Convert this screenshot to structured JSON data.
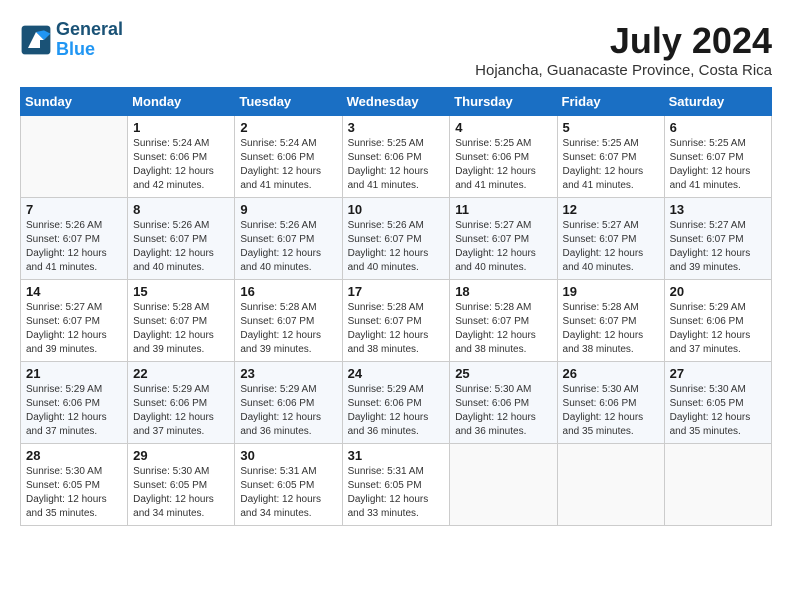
{
  "header": {
    "logo_line1": "General",
    "logo_line2": "Blue",
    "month_year": "July 2024",
    "location": "Hojancha, Guanacaste Province, Costa Rica"
  },
  "columns": [
    "Sunday",
    "Monday",
    "Tuesday",
    "Wednesday",
    "Thursday",
    "Friday",
    "Saturday"
  ],
  "weeks": [
    [
      {
        "day": "",
        "sunrise": "",
        "sunset": "",
        "daylight": ""
      },
      {
        "day": "1",
        "sunrise": "Sunrise: 5:24 AM",
        "sunset": "Sunset: 6:06 PM",
        "daylight": "Daylight: 12 hours and 42 minutes."
      },
      {
        "day": "2",
        "sunrise": "Sunrise: 5:24 AM",
        "sunset": "Sunset: 6:06 PM",
        "daylight": "Daylight: 12 hours and 41 minutes."
      },
      {
        "day": "3",
        "sunrise": "Sunrise: 5:25 AM",
        "sunset": "Sunset: 6:06 PM",
        "daylight": "Daylight: 12 hours and 41 minutes."
      },
      {
        "day": "4",
        "sunrise": "Sunrise: 5:25 AM",
        "sunset": "Sunset: 6:06 PM",
        "daylight": "Daylight: 12 hours and 41 minutes."
      },
      {
        "day": "5",
        "sunrise": "Sunrise: 5:25 AM",
        "sunset": "Sunset: 6:07 PM",
        "daylight": "Daylight: 12 hours and 41 minutes."
      },
      {
        "day": "6",
        "sunrise": "Sunrise: 5:25 AM",
        "sunset": "Sunset: 6:07 PM",
        "daylight": "Daylight: 12 hours and 41 minutes."
      }
    ],
    [
      {
        "day": "7",
        "sunrise": "Sunrise: 5:26 AM",
        "sunset": "Sunset: 6:07 PM",
        "daylight": "Daylight: 12 hours and 41 minutes."
      },
      {
        "day": "8",
        "sunrise": "Sunrise: 5:26 AM",
        "sunset": "Sunset: 6:07 PM",
        "daylight": "Daylight: 12 hours and 40 minutes."
      },
      {
        "day": "9",
        "sunrise": "Sunrise: 5:26 AM",
        "sunset": "Sunset: 6:07 PM",
        "daylight": "Daylight: 12 hours and 40 minutes."
      },
      {
        "day": "10",
        "sunrise": "Sunrise: 5:26 AM",
        "sunset": "Sunset: 6:07 PM",
        "daylight": "Daylight: 12 hours and 40 minutes."
      },
      {
        "day": "11",
        "sunrise": "Sunrise: 5:27 AM",
        "sunset": "Sunset: 6:07 PM",
        "daylight": "Daylight: 12 hours and 40 minutes."
      },
      {
        "day": "12",
        "sunrise": "Sunrise: 5:27 AM",
        "sunset": "Sunset: 6:07 PM",
        "daylight": "Daylight: 12 hours and 40 minutes."
      },
      {
        "day": "13",
        "sunrise": "Sunrise: 5:27 AM",
        "sunset": "Sunset: 6:07 PM",
        "daylight": "Daylight: 12 hours and 39 minutes."
      }
    ],
    [
      {
        "day": "14",
        "sunrise": "Sunrise: 5:27 AM",
        "sunset": "Sunset: 6:07 PM",
        "daylight": "Daylight: 12 hours and 39 minutes."
      },
      {
        "day": "15",
        "sunrise": "Sunrise: 5:28 AM",
        "sunset": "Sunset: 6:07 PM",
        "daylight": "Daylight: 12 hours and 39 minutes."
      },
      {
        "day": "16",
        "sunrise": "Sunrise: 5:28 AM",
        "sunset": "Sunset: 6:07 PM",
        "daylight": "Daylight: 12 hours and 39 minutes."
      },
      {
        "day": "17",
        "sunrise": "Sunrise: 5:28 AM",
        "sunset": "Sunset: 6:07 PM",
        "daylight": "Daylight: 12 hours and 38 minutes."
      },
      {
        "day": "18",
        "sunrise": "Sunrise: 5:28 AM",
        "sunset": "Sunset: 6:07 PM",
        "daylight": "Daylight: 12 hours and 38 minutes."
      },
      {
        "day": "19",
        "sunrise": "Sunrise: 5:28 AM",
        "sunset": "Sunset: 6:07 PM",
        "daylight": "Daylight: 12 hours and 38 minutes."
      },
      {
        "day": "20",
        "sunrise": "Sunrise: 5:29 AM",
        "sunset": "Sunset: 6:06 PM",
        "daylight": "Daylight: 12 hours and 37 minutes."
      }
    ],
    [
      {
        "day": "21",
        "sunrise": "Sunrise: 5:29 AM",
        "sunset": "Sunset: 6:06 PM",
        "daylight": "Daylight: 12 hours and 37 minutes."
      },
      {
        "day": "22",
        "sunrise": "Sunrise: 5:29 AM",
        "sunset": "Sunset: 6:06 PM",
        "daylight": "Daylight: 12 hours and 37 minutes."
      },
      {
        "day": "23",
        "sunrise": "Sunrise: 5:29 AM",
        "sunset": "Sunset: 6:06 PM",
        "daylight": "Daylight: 12 hours and 36 minutes."
      },
      {
        "day": "24",
        "sunrise": "Sunrise: 5:29 AM",
        "sunset": "Sunset: 6:06 PM",
        "daylight": "Daylight: 12 hours and 36 minutes."
      },
      {
        "day": "25",
        "sunrise": "Sunrise: 5:30 AM",
        "sunset": "Sunset: 6:06 PM",
        "daylight": "Daylight: 12 hours and 36 minutes."
      },
      {
        "day": "26",
        "sunrise": "Sunrise: 5:30 AM",
        "sunset": "Sunset: 6:06 PM",
        "daylight": "Daylight: 12 hours and 35 minutes."
      },
      {
        "day": "27",
        "sunrise": "Sunrise: 5:30 AM",
        "sunset": "Sunset: 6:05 PM",
        "daylight": "Daylight: 12 hours and 35 minutes."
      }
    ],
    [
      {
        "day": "28",
        "sunrise": "Sunrise: 5:30 AM",
        "sunset": "Sunset: 6:05 PM",
        "daylight": "Daylight: 12 hours and 35 minutes."
      },
      {
        "day": "29",
        "sunrise": "Sunrise: 5:30 AM",
        "sunset": "Sunset: 6:05 PM",
        "daylight": "Daylight: 12 hours and 34 minutes."
      },
      {
        "day": "30",
        "sunrise": "Sunrise: 5:31 AM",
        "sunset": "Sunset: 6:05 PM",
        "daylight": "Daylight: 12 hours and 34 minutes."
      },
      {
        "day": "31",
        "sunrise": "Sunrise: 5:31 AM",
        "sunset": "Sunset: 6:05 PM",
        "daylight": "Daylight: 12 hours and 33 minutes."
      },
      {
        "day": "",
        "sunrise": "",
        "sunset": "",
        "daylight": ""
      },
      {
        "day": "",
        "sunrise": "",
        "sunset": "",
        "daylight": ""
      },
      {
        "day": "",
        "sunrise": "",
        "sunset": "",
        "daylight": ""
      }
    ]
  ]
}
